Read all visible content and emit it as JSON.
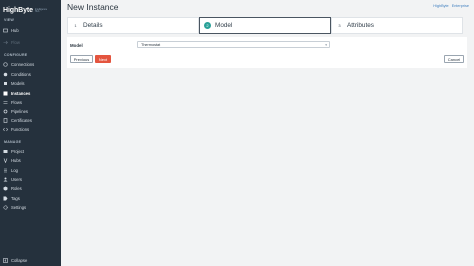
{
  "brand": {
    "name": "HighByte",
    "tagline": "Intelligence Hub"
  },
  "sidebar": {
    "sections": [
      {
        "label": "VIEW",
        "items": [
          {
            "label": "Hub",
            "icon": "home-icon",
            "state": "normal"
          },
          {
            "label": "Flow",
            "icon": "flow-icon",
            "state": "disabled"
          }
        ]
      },
      {
        "label": "CONFIGURE",
        "items": [
          {
            "label": "Connections",
            "icon": "connections-icon",
            "state": "normal"
          },
          {
            "label": "Conditions",
            "icon": "conditions-icon",
            "state": "normal"
          },
          {
            "label": "Models",
            "icon": "models-icon",
            "state": "normal"
          },
          {
            "label": "Instances",
            "icon": "instances-icon",
            "state": "active"
          },
          {
            "label": "Flows",
            "icon": "flows-icon",
            "state": "normal"
          },
          {
            "label": "Pipelines",
            "icon": "pipelines-icon",
            "state": "normal"
          },
          {
            "label": "Certificates",
            "icon": "certificates-icon",
            "state": "normal"
          },
          {
            "label": "Functions",
            "icon": "functions-icon",
            "state": "normal"
          }
        ]
      },
      {
        "label": "MANAGE",
        "items": [
          {
            "label": "Project",
            "icon": "project-icon",
            "state": "normal"
          },
          {
            "label": "Hubs",
            "icon": "hubs-icon",
            "state": "normal"
          },
          {
            "label": "Log",
            "icon": "log-icon",
            "state": "normal"
          },
          {
            "label": "Users",
            "icon": "users-icon",
            "state": "normal"
          },
          {
            "label": "Roles",
            "icon": "roles-icon",
            "state": "normal"
          },
          {
            "label": "Tags",
            "icon": "tags-icon",
            "state": "normal"
          },
          {
            "label": "Settings",
            "icon": "settings-icon",
            "state": "normal"
          }
        ]
      }
    ],
    "collapse_label": "Collapse"
  },
  "header": {
    "title": "New Instance",
    "user_links": [
      "HighByte",
      "Enterprise"
    ]
  },
  "steps": [
    {
      "number": "1",
      "label": "Details",
      "active": false
    },
    {
      "number": "2",
      "label": "Model",
      "active": true
    },
    {
      "number": "3",
      "label": "Attributes",
      "active": false
    }
  ],
  "form": {
    "model_label": "Model",
    "model_value": "Thermostat"
  },
  "buttons": {
    "previous": "Previous",
    "next": "Next",
    "cancel": "Cancel"
  },
  "colors": {
    "sidebar_bg": "#25313d",
    "accent_active_step": "#2aa198",
    "next_button": "#e4553f",
    "link": "#3f7fbf"
  }
}
